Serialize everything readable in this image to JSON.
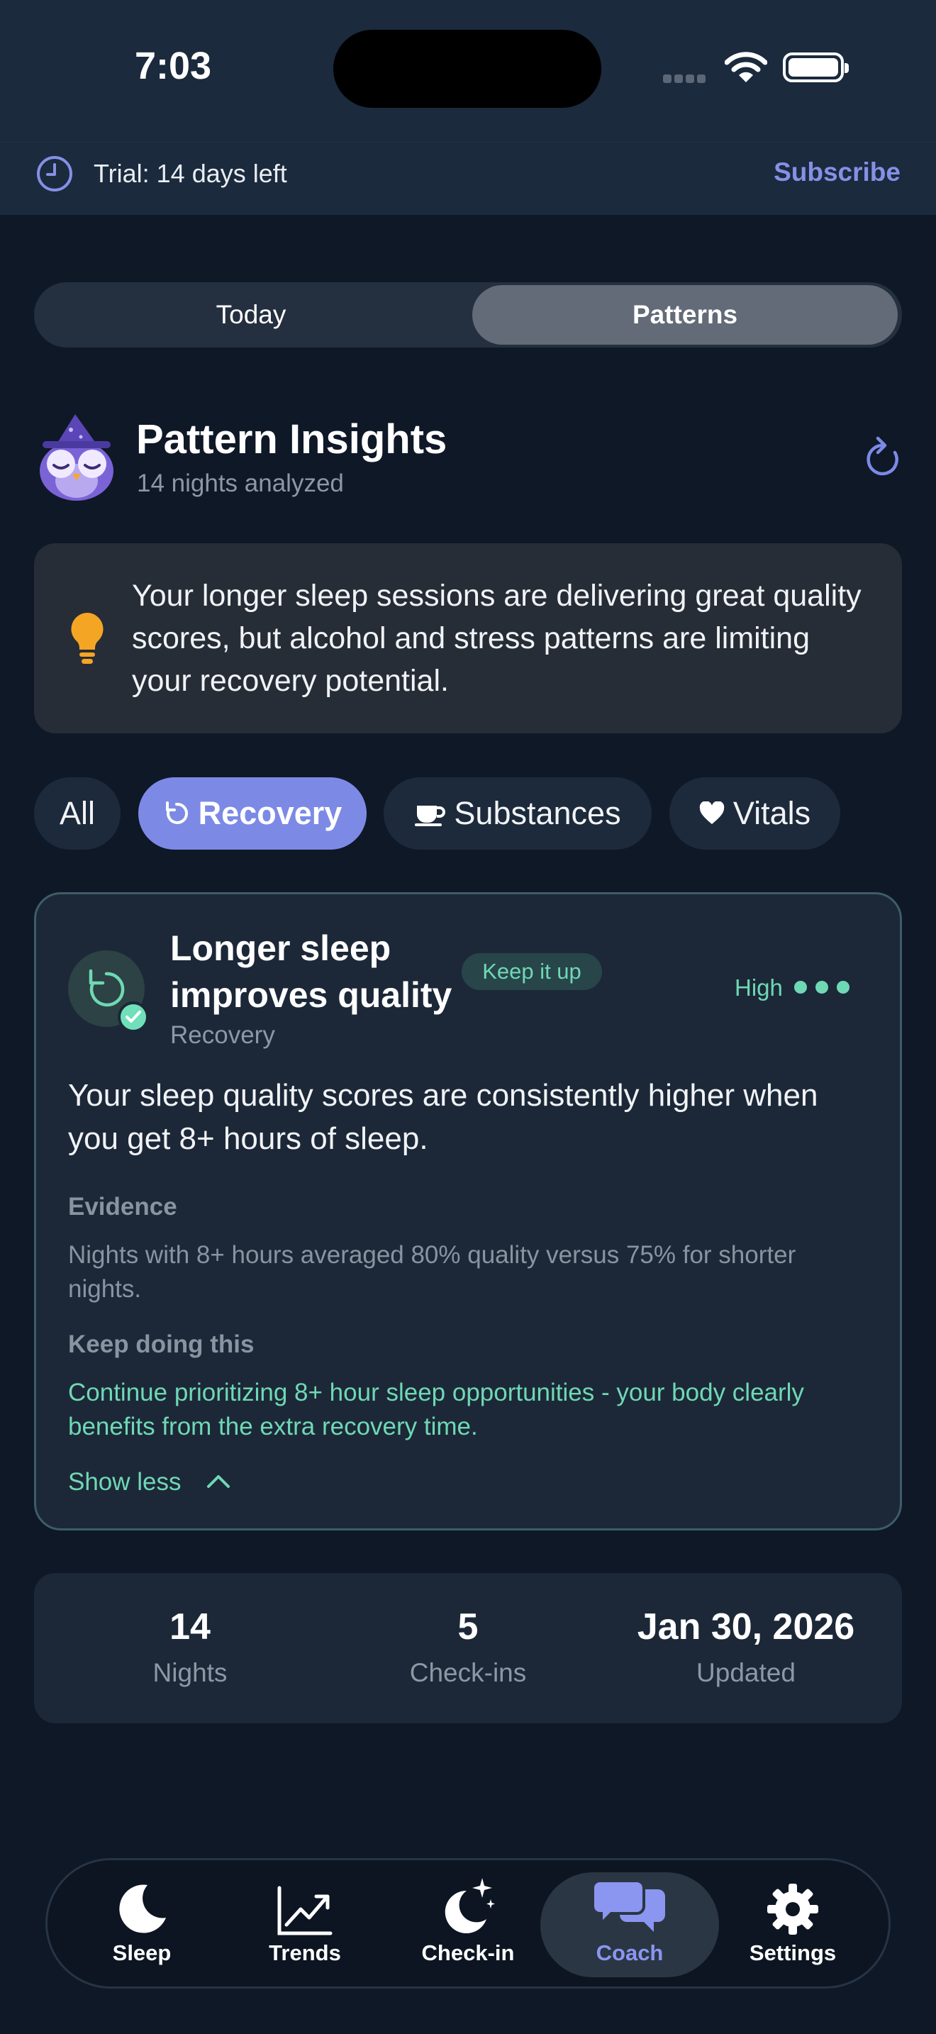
{
  "status_bar": {
    "time": "7:03"
  },
  "trial_banner": {
    "text": "Trial: 14 days left",
    "action": "Subscribe"
  },
  "segmented": {
    "options": [
      "Today",
      "Patterns"
    ],
    "selected": "Patterns"
  },
  "header": {
    "title": "Pattern Insights",
    "subtitle": "14 nights analyzed"
  },
  "summary": {
    "text": "Your longer sleep sessions are delivering great quality scores, but alcohol and stress patterns are limiting your recovery potential."
  },
  "filters": {
    "items": [
      "All",
      "Recovery",
      "Substances",
      "Vitals"
    ],
    "selected": "Recovery"
  },
  "insight": {
    "title": "Longer sleep improves quality",
    "badge": "Keep it up",
    "category": "Recovery",
    "confidence": "High",
    "description": "Your sleep quality scores are consistently higher when you get 8+ hours of sleep.",
    "evidence_label": "Evidence",
    "evidence": "Nights with 8+ hours averaged 80% quality versus 75% for shorter nights.",
    "keep_label": "Keep doing this",
    "keep_text": "Continue prioritizing 8+ hour sleep opportunities - your body clearly benefits from the extra recovery time.",
    "toggle": "Show less"
  },
  "stats": [
    {
      "value": "14",
      "label": "Nights"
    },
    {
      "value": "5",
      "label": "Check-ins"
    },
    {
      "value": "Jan 30, 2026",
      "label": "Updated"
    }
  ],
  "tabbar": {
    "items": [
      {
        "label": "Sleep",
        "icon": "moon-icon"
      },
      {
        "label": "Trends",
        "icon": "trend-chart-icon"
      },
      {
        "label": "Check-in",
        "icon": "moon-stars-icon"
      },
      {
        "label": "Coach",
        "icon": "chat-bubbles-icon"
      },
      {
        "label": "Settings",
        "icon": "gear-icon"
      }
    ],
    "selected": "Coach"
  },
  "colors": {
    "background": "#0f1827",
    "accent": "#7c8ae6",
    "positive": "#6fd8b4",
    "bulb": "#f5a524"
  }
}
